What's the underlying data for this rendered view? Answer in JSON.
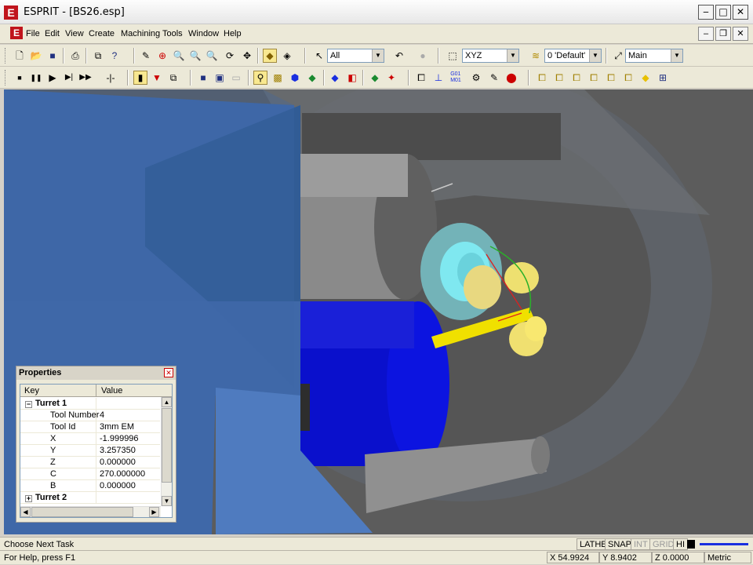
{
  "window": {
    "title": "ESPRIT - [BS26.esp]",
    "app_icon": "E"
  },
  "menu": {
    "items": [
      "File",
      "Edit",
      "View",
      "Create",
      "Machining",
      "Tools",
      "Window",
      "Help"
    ]
  },
  "toolbar1": {
    "filter_value": "All",
    "plane_value": "XYZ",
    "layer_value": "0 'Default'",
    "view_value": "Main"
  },
  "properties": {
    "title": "Properties",
    "columns": [
      "Key",
      "Value"
    ],
    "rows": [
      {
        "key": "Turret 1",
        "value": "",
        "group": true,
        "expander": "−"
      },
      {
        "key": "Tool Number",
        "value": "4"
      },
      {
        "key": "Tool Id",
        "value": "3mm EM"
      },
      {
        "key": "X",
        "value": "-1.999996"
      },
      {
        "key": "Y",
        "value": "3.257350"
      },
      {
        "key": "Z",
        "value": "0.000000"
      },
      {
        "key": "C",
        "value": "270.000000"
      },
      {
        "key": "B",
        "value": "0.000000"
      },
      {
        "key": "Turret 2",
        "value": "",
        "group": true,
        "expander": "+"
      }
    ]
  },
  "status": {
    "task": "Choose Next Task",
    "help": "For Help, press F1",
    "modes": [
      "LATHE",
      "SNAP",
      "INT",
      "GRID",
      "HI"
    ],
    "x": "X 54.9924",
    "y": "Y 8.9402",
    "z": "Z 0.0000",
    "units": "Metric"
  },
  "colors": {
    "viewport": "#5a5a5a",
    "highlight": "#ffe000",
    "selection": "#1a2fe0"
  }
}
